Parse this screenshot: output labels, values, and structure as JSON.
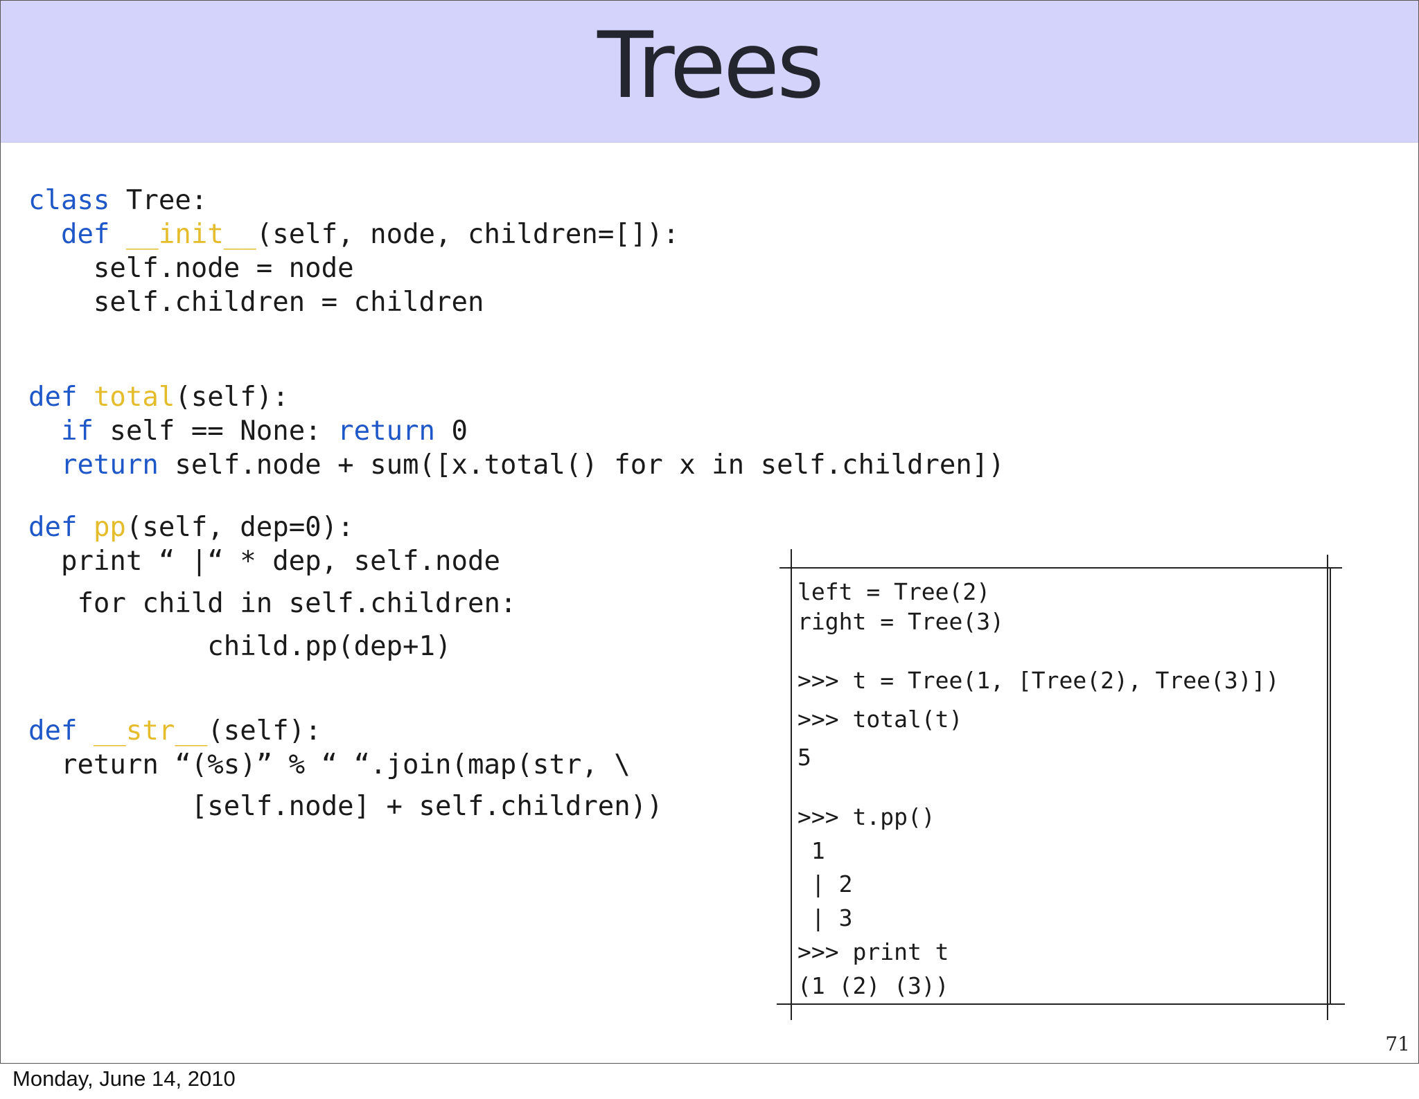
{
  "slide": {
    "title": "Trees",
    "page_number": "71"
  },
  "footer": {
    "date": "Monday, June 14, 2010"
  },
  "code": {
    "l1": {
      "kw": "class",
      "rest": " Tree:"
    },
    "l2": {
      "indent": "  ",
      "kw": "def",
      "sp": " ",
      "fn": "__init__",
      "rest": "(self, node, children=[]):"
    },
    "l3": "    self.node = node",
    "l4": "    self.children = children",
    "l5": {
      "kw": "def",
      "sp": " ",
      "fn": "total",
      "rest": "(self):"
    },
    "l6": {
      "indent": "  ",
      "kw": "if",
      "mid": " self == None: ",
      "kw2": "return",
      "rest": " 0"
    },
    "l7": {
      "indent": "  ",
      "kw": "return",
      "rest": " self.node + sum([x.total() for x in self.children])"
    },
    "l8": {
      "kw": "def",
      "sp": " ",
      "fn": "pp",
      "rest": "(self, dep=0):"
    },
    "l9": "  print “ |“ * dep, self.node",
    "l10": "   for child in self.children:",
    "l11": "           child.pp(dep+1)",
    "l12": {
      "kw": "def",
      "sp": " ",
      "fn": "__str__",
      "rest": "(self):"
    },
    "l13": "  return “(%s)” % “ “.join(map(str, \\",
    "l14": "          [self.node] + self.children))"
  },
  "console": {
    "c1": "left = Tree(2)",
    "c2": "right = Tree(3)",
    "c3": ">>> t = Tree(1, [Tree(2), Tree(3)])",
    "c4": ">>> total(t)",
    "c5": "5",
    "c6": ">>> t.pp()",
    "c7": " 1",
    "c8": " | 2",
    "c9": " | 3",
    "c10": ">>> print t",
    "c11": "(1 (2) (3))"
  }
}
